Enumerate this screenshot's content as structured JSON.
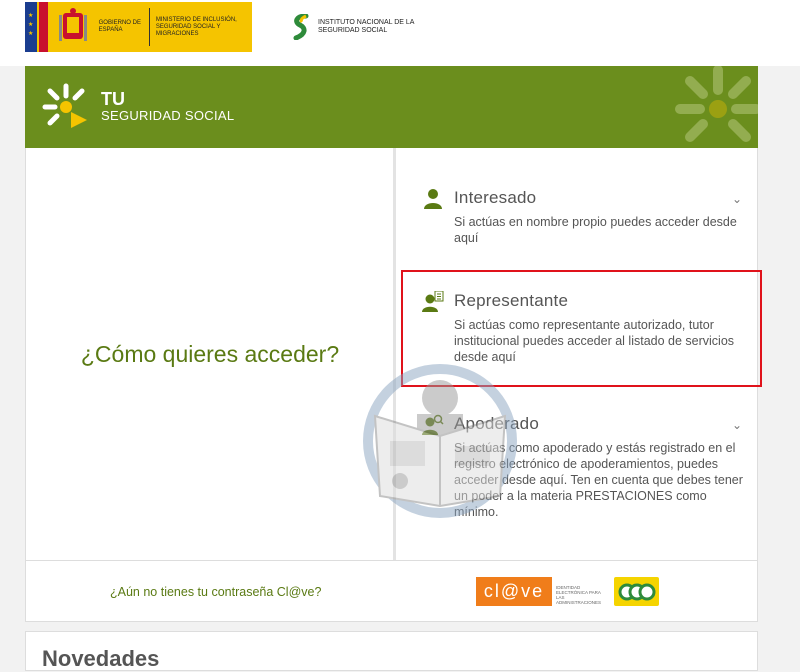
{
  "topbar": {
    "gob_line1": "Gobierno de España",
    "gob_line2": "Ministerio de Inclusión, Seguridad Social y Migraciones",
    "inss_name": "Instituto Nacional de la Seguridad Social"
  },
  "header": {
    "brand_tu": "TU",
    "brand_ss": "SEGURIDAD SOCIAL",
    "color": "#6b8e1d"
  },
  "main": {
    "question": "¿Cómo quieres acceder?",
    "options": [
      {
        "title": "Interesado",
        "description": "Si actúas en nombre propio puedes acceder desde aquí",
        "icon": "person-icon",
        "expandable": true
      },
      {
        "title": "Representante",
        "description": "Si actúas como representante autorizado, tutor institucional puedes acceder al listado de servicios desde aquí",
        "icon": "person-document-icon",
        "expandable": false,
        "highlighted": true
      },
      {
        "title": "Apoderado",
        "description": "Si actúas como apoderado y estás registrado en el registro electrónico de apoderamientos, puedes acceder desde aquí. Ten en cuenta que debes tener un poder a la materia PRESTACIONES como mínimo.",
        "icon": "person-search-icon",
        "expandable": true
      }
    ]
  },
  "footer": {
    "clave_link": "¿Aún no tienes tu contraseña Cl@ve?",
    "clave_logo": "cl@ve",
    "clave_sub": "Identidad electrónica para las administraciones"
  },
  "news": {
    "title": "Novedades"
  },
  "colors": {
    "accent": "#6b8e1d",
    "highlight_border": "#e0121b",
    "clave_orange": "#f07d1a"
  }
}
